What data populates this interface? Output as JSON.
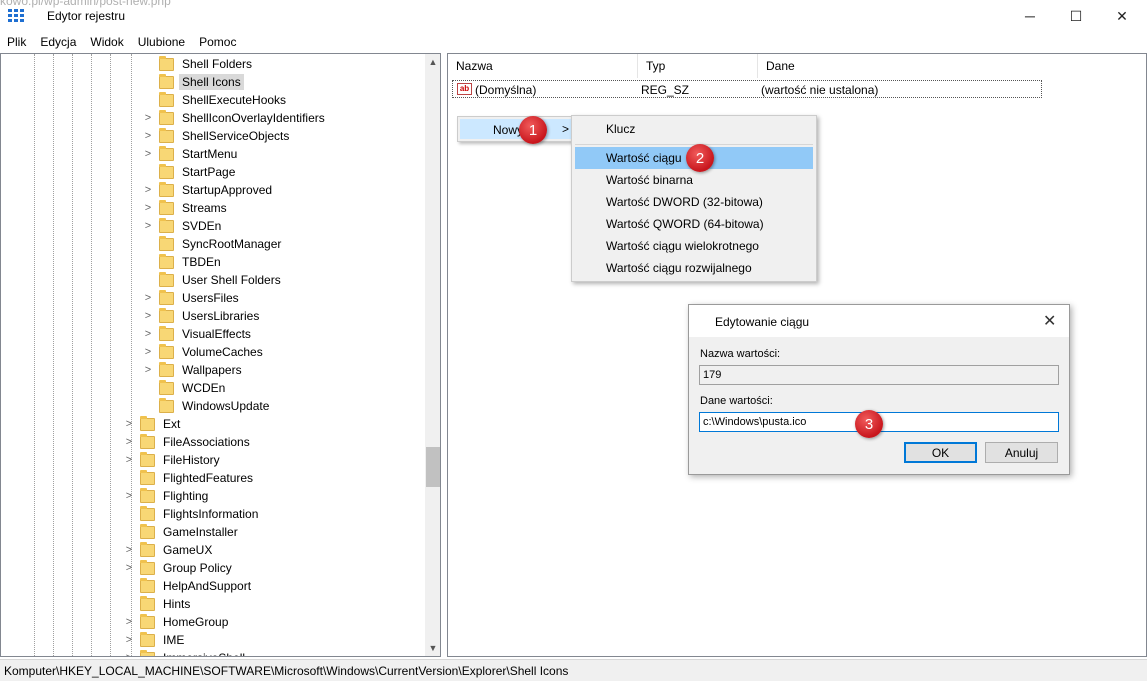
{
  "window": {
    "ghost_title": "kowo.pl/wp-admin/post-new.php",
    "title": "Edytor rejestru",
    "controls": {
      "minimize": "─",
      "maximize": "☐",
      "close": "✕"
    }
  },
  "menu": [
    "Plik",
    "Edycja",
    "Widok",
    "Ulubione",
    "Pomoc"
  ],
  "tree": {
    "level3": [
      {
        "label": "Shell Folders",
        "expand": ""
      },
      {
        "label": "Shell Icons",
        "expand": "",
        "selected": true
      },
      {
        "label": "ShellExecuteHooks",
        "expand": ""
      },
      {
        "label": "ShellIconOverlayIdentifiers",
        "expand": ">"
      },
      {
        "label": "ShellServiceObjects",
        "expand": ">"
      },
      {
        "label": "StartMenu",
        "expand": ">"
      },
      {
        "label": "StartPage",
        "expand": ""
      },
      {
        "label": "StartupApproved",
        "expand": ">"
      },
      {
        "label": "Streams",
        "expand": ">"
      },
      {
        "label": "SVDEn",
        "expand": ">"
      },
      {
        "label": "SyncRootManager",
        "expand": ""
      },
      {
        "label": "TBDEn",
        "expand": ""
      },
      {
        "label": "User Shell Folders",
        "expand": ""
      },
      {
        "label": "UsersFiles",
        "expand": ">"
      },
      {
        "label": "UsersLibraries",
        "expand": ">"
      },
      {
        "label": "VisualEffects",
        "expand": ">"
      },
      {
        "label": "VolumeCaches",
        "expand": ">"
      },
      {
        "label": "Wallpapers",
        "expand": ">"
      },
      {
        "label": "WCDEn",
        "expand": ""
      },
      {
        "label": "WindowsUpdate",
        "expand": ""
      }
    ],
    "level2": [
      {
        "label": "Ext",
        "expand": ">"
      },
      {
        "label": "FileAssociations",
        "expand": ">"
      },
      {
        "label": "FileHistory",
        "expand": ">"
      },
      {
        "label": "FlightedFeatures",
        "expand": ""
      },
      {
        "label": "Flighting",
        "expand": ">"
      },
      {
        "label": "FlightsInformation",
        "expand": ""
      },
      {
        "label": "GameInstaller",
        "expand": ""
      },
      {
        "label": "GameUX",
        "expand": ">"
      },
      {
        "label": "Group Policy",
        "expand": ">"
      },
      {
        "label": "HelpAndSupport",
        "expand": ""
      },
      {
        "label": "Hints",
        "expand": ""
      },
      {
        "label": "HomeGroup",
        "expand": ">"
      },
      {
        "label": "IME",
        "expand": ">"
      },
      {
        "label": "ImmersiveShell",
        "expand": ">"
      }
    ]
  },
  "list": {
    "columns": [
      "Nazwa",
      "Typ",
      "Dane"
    ],
    "row": {
      "name": "(Domyślna)",
      "type": "REG_SZ",
      "data": "(wartość nie ustalona)",
      "icon_text": "ab"
    }
  },
  "context_menu": {
    "parent_label": "Nowy",
    "chevron": ">",
    "items": [
      "Klucz",
      "Wartość ciągu",
      "Wartość binarna",
      "Wartość DWORD (32-bitowa)",
      "Wartość QWORD (64-bitowa)",
      "Wartość ciągu wielokrotnego",
      "Wartość ciągu rozwijalnego"
    ],
    "highlight_index": 1
  },
  "badges": [
    "1",
    "2",
    "3"
  ],
  "dialog": {
    "title": "Edytowanie ciągu",
    "close": "✕",
    "name_label": "Nazwa wartości:",
    "name_value": "179",
    "data_label": "Dane wartości:",
    "data_value": "c:\\Windows\\pusta.ico",
    "ok": "OK",
    "cancel": "Anuluj"
  },
  "status": "Komputer\\HKEY_LOCAL_MACHINE\\SOFTWARE\\Microsoft\\Windows\\CurrentVersion\\Explorer\\Shell Icons",
  "scrollbar": {
    "up": "▲",
    "down": "▼"
  },
  "colors": {
    "selection": "#d9d9d9",
    "menu_highlight": "#91c9f7",
    "badge": "#c8161d",
    "accent": "#0078d7"
  }
}
